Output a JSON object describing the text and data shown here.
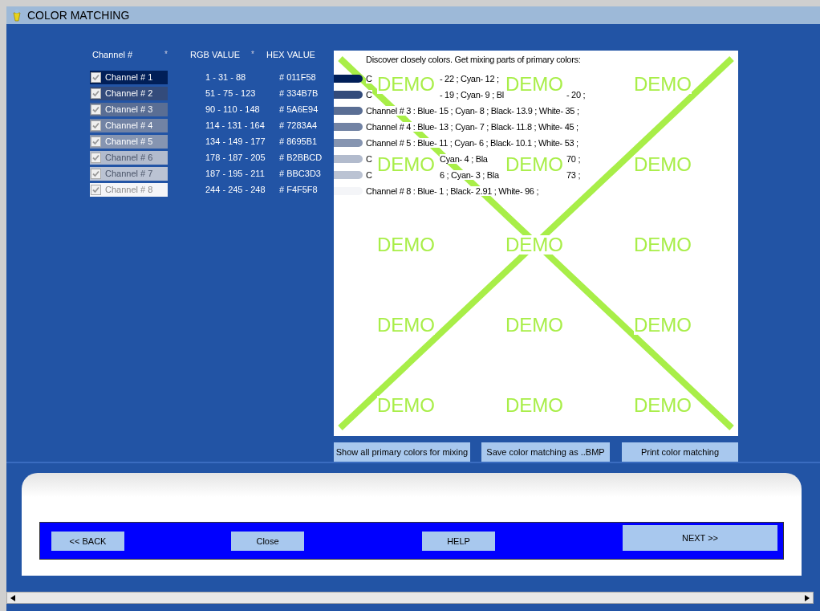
{
  "window": {
    "title": "COLOR MATCHING"
  },
  "headers": [
    "Channel #",
    "*",
    "RGB VALUE",
    "*",
    "HEX  VALUE"
  ],
  "channels": [
    {
      "label": "Channel # 1",
      "checked": true,
      "color": "#011f58",
      "rgb": "1 - 31 - 88",
      "hex": "# 011F58"
    },
    {
      "label": "Channel # 2",
      "checked": true,
      "color": "#334b7b",
      "rgb": "51 - 75 - 123",
      "hex": "# 334B7B"
    },
    {
      "label": "Channel # 3",
      "checked": true,
      "color": "#5a6e94",
      "rgb": "90 - 110 - 148",
      "hex": "# 5A6E94"
    },
    {
      "label": "Channel # 4",
      "checked": true,
      "color": "#7283a4",
      "rgb": "114 - 131 - 164",
      "hex": "# 7283A4"
    },
    {
      "label": "Channel # 5",
      "checked": true,
      "color": "#8695b1",
      "rgb": "134 - 149 - 177",
      "hex": "# 8695B1"
    },
    {
      "label": "Channel # 6",
      "checked": true,
      "color": "#b2bbcd",
      "rgb": "178 - 187 - 205",
      "hex": "# B2BBCD"
    },
    {
      "label": "Channel # 7",
      "checked": true,
      "color": "#bbc3d3",
      "rgb": "187 - 195 - 211",
      "hex": "# BBC3D3"
    },
    {
      "label": "Channel # 8",
      "checked": true,
      "color": "#f4f5f8",
      "rgb": "244 - 245 - 248",
      "hex": "# F4F5F8"
    }
  ],
  "result": {
    "heading": "Discover closely colors. Get mixing parts of primary colors:",
    "rows": [
      {
        "parts": [
          "C",
          "- 22 ; Cyan- 12 ;"
        ]
      },
      {
        "parts": [
          "C",
          "- 19 ; Cyan- 9 ; Bl",
          "- 20 ;"
        ]
      },
      {
        "parts": [
          "Channel # 3 : Blue- 15 ; Cyan- 8 ; Black- 13.9 ; White- 35 ;"
        ]
      },
      {
        "parts": [
          "Channel # 4 : Blue- 13 ; Cyan- 7 ; Black- 11.8 ; White- 45 ;"
        ]
      },
      {
        "parts": [
          "Channel # 5 : Blue- 11 ; Cyan- 6 ; Black- 10.1 ; White- 53 ;"
        ]
      },
      {
        "parts": [
          "C",
          "Cyan- 4 ; Bla",
          "70 ;"
        ]
      },
      {
        "parts": [
          "C",
          "6 ; Cyan- 3 ; Bla",
          "73 ;"
        ]
      },
      {
        "parts": [
          "Channel # 8 : Blue- 1 ; Black- 2.91 ; White- 96 ;"
        ]
      }
    ],
    "demo_marks": [
      "DEMO",
      "DEMO",
      "DEMO",
      "DEMO",
      "DEMO",
      "DEMO",
      "DEMO",
      "DEMO",
      "DEMO",
      "DEMO",
      "DEMO",
      "DEMO",
      "DEMO",
      "DEMO",
      "DEMO"
    ]
  },
  "actions": [
    "Show all primary colors for mixing",
    "Save color matching as ..BMP",
    "Print color matching"
  ],
  "nav": [
    "<< BACK",
    "Close",
    "HELP",
    "NEXT >>"
  ]
}
